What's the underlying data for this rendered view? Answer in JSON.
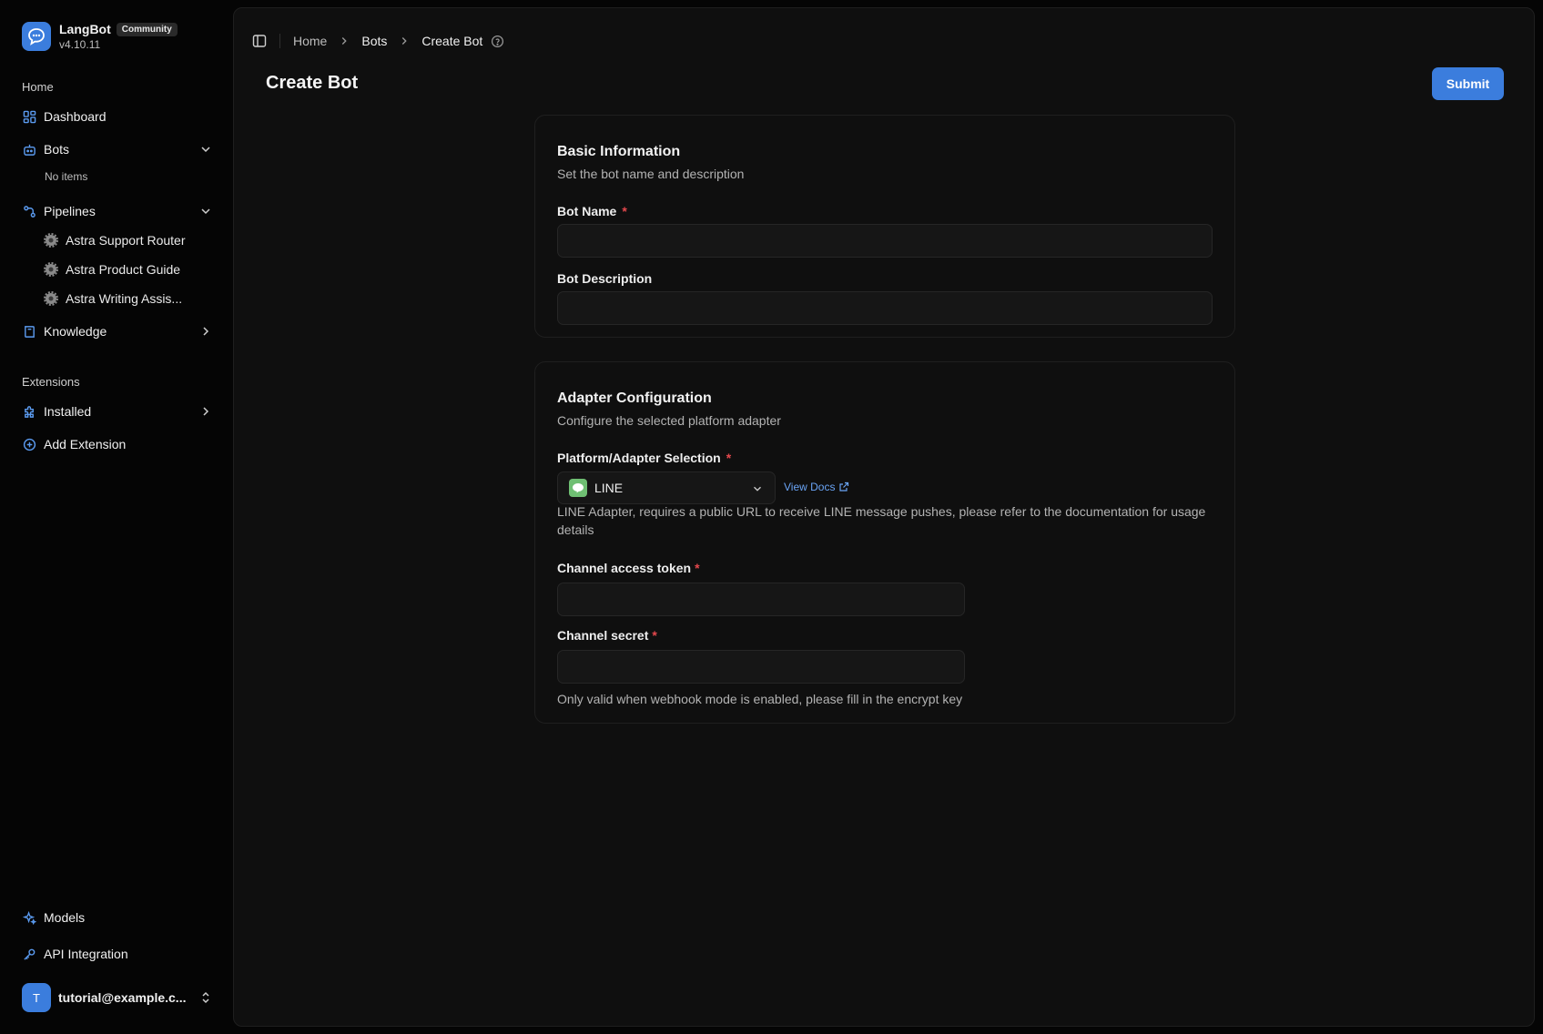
{
  "brand": {
    "name": "LangBot",
    "badge": "Community",
    "version": "v4.10.11"
  },
  "sidebar": {
    "home_label": "Home",
    "dashboard": "Dashboard",
    "bots": "Bots",
    "bots_empty": "No items",
    "pipelines": "Pipelines",
    "pipeline_items": [
      "Astra Support Router",
      "Astra Product Guide",
      "Astra Writing Assis..."
    ],
    "knowledge": "Knowledge",
    "extensions_label": "Extensions",
    "installed": "Installed",
    "add_extension": "Add Extension",
    "models": "Models",
    "api_integration": "API Integration",
    "user": {
      "initial": "T",
      "email": "tutorial@example.c..."
    }
  },
  "breadcrumb": [
    "Home",
    "Bots",
    "Create Bot"
  ],
  "page": {
    "title": "Create Bot",
    "submit": "Submit"
  },
  "basic": {
    "title": "Basic Information",
    "desc": "Set the bot name and description",
    "name_label": "Bot Name",
    "name_value": "",
    "desc_label": "Bot Description",
    "desc_value": ""
  },
  "adapter": {
    "title": "Adapter Configuration",
    "desc": "Configure the selected platform adapter",
    "platform_label": "Platform/Adapter Selection",
    "platform_value": "LINE",
    "docs_link": "View Docs",
    "adapter_help": "LINE Adapter, requires a public URL to receive LINE message pushes, please refer to the documentation for usage details",
    "token_label": "Channel access token",
    "secret_label": "Channel secret",
    "secret_help": "Only valid when webhook mode is enabled, please fill in the encrypt key"
  },
  "colors": {
    "accent": "#3b7ddd",
    "required": "#e5484d",
    "link": "#6aa4f5",
    "line_brand": "#6fbf73"
  }
}
